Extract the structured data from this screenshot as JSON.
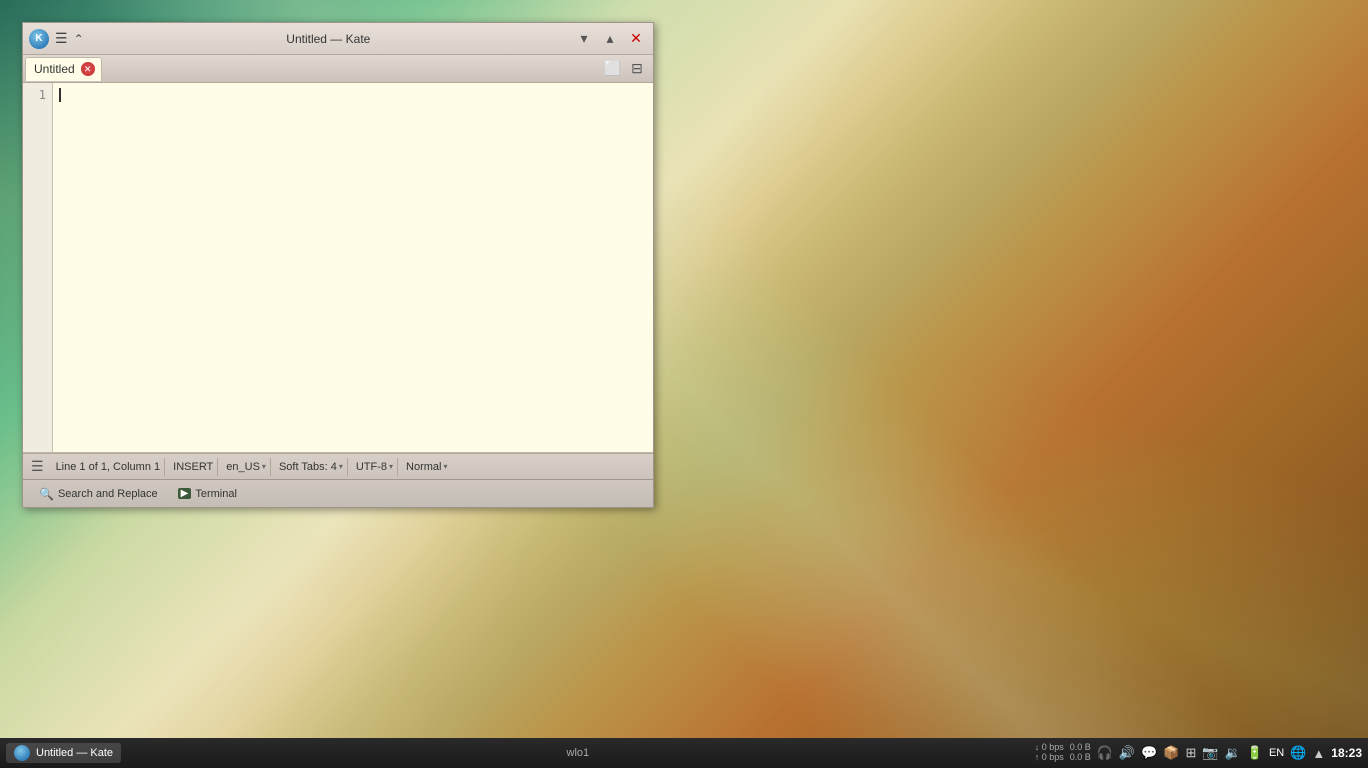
{
  "desktop": {
    "background": "abstract geometric colorful"
  },
  "kate_window": {
    "title": "Untitled — Kate",
    "logo_text": "K"
  },
  "title_bar": {
    "title": "Untitled — Kate",
    "minimize_label": "▾",
    "maximize_label": "▴",
    "close_label": "✕"
  },
  "tab_bar": {
    "tab_title": "Untitled",
    "close_tab": "✕",
    "new_file_icon": "📄",
    "split_icon": "⊟"
  },
  "editor": {
    "line_number": "1",
    "content": ""
  },
  "status_bar": {
    "hamburger": "☰",
    "position": "Line 1 of 1, Column 1",
    "mode": "INSERT",
    "language": "en_US",
    "language_chevron": "▾",
    "indent": "Soft Tabs: 4",
    "indent_chevron": "▾",
    "encoding": "UTF-8",
    "encoding_chevron": "▾",
    "highlight": "Normal",
    "highlight_chevron": "▾"
  },
  "bottom_toolbar": {
    "search_icon": "🔍",
    "search_label": "Search and Replace",
    "terminal_icon": "▶",
    "terminal_label": "Terminal"
  },
  "taskbar": {
    "app_title": "Untitled — Kate",
    "network_label": "wlo1",
    "net_down": "↓ 0 bps",
    "net_up": "↑ 0 bps",
    "data_down": "0.0 B",
    "data_up": "0.0 B",
    "locale": "EN",
    "time": "18:23",
    "icons": [
      "🔊",
      "🔋",
      "🌐",
      "▲"
    ]
  }
}
